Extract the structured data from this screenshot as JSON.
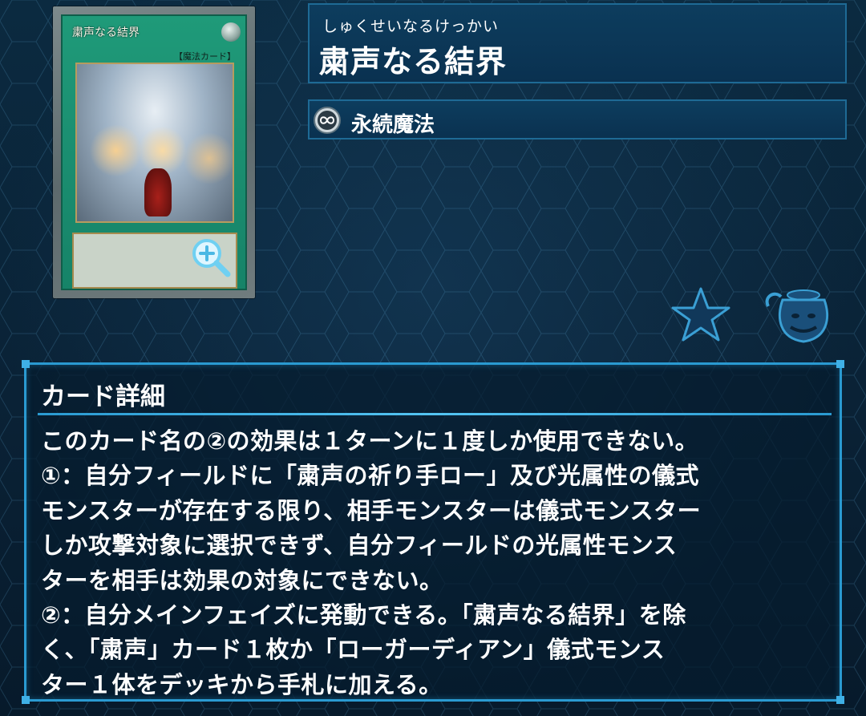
{
  "card": {
    "ruby": "しゅくせいなるけっかい",
    "name": "粛声なる結界",
    "art_name": "粛声なる結界",
    "art_type": "【魔法カード】",
    "type": "永続魔法",
    "type_icon": "continuous-infinity-icon"
  },
  "actions": {
    "zoom_icon": "magnifier-plus-icon",
    "favorite_icon": "star-icon",
    "jar_icon": "pot-of-greed-icon"
  },
  "detail": {
    "title": "カード詳細",
    "lines": [
      "このカード名の②の効果は１ターンに１度しか使用できない。",
      "①：自分フィールドに「粛声の祈り手ロー」及び光属性の儀式",
      "モンスターが存在する限り、相手モンスターは儀式モンスター",
      "しか攻撃対象に選択できず、自分フィールドの光属性モンス",
      "ターを相手は効果の対象にできない。",
      "②：自分メインフェイズに発動できる。「粛声なる結界」を除",
      "く、「粛声」カード１枚か「ローガーディアン」儀式モンス",
      "ター１体をデッキから手札に加える。"
    ]
  },
  "colors": {
    "panel_border": "#1e6a95",
    "detail_border": "#2a9ad1",
    "spell_green": "#1f9a79",
    "background": "#0a2236"
  }
}
